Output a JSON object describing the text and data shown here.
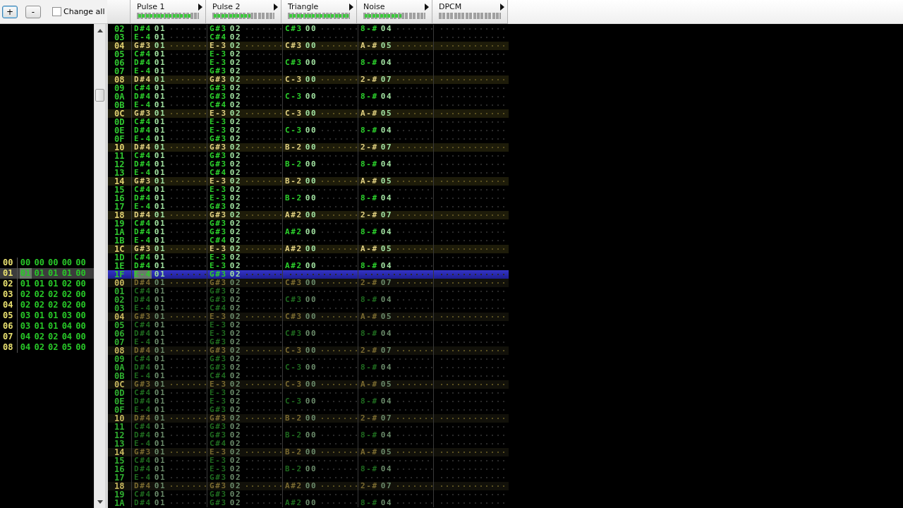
{
  "toolbar": {
    "buttons": [
      {
        "label": "+",
        "focused": true
      },
      {
        "label": "-",
        "focused": false
      }
    ],
    "change_all": {
      "label": "Change all",
      "checked": false
    }
  },
  "channels": [
    {
      "name": "Pulse 1",
      "level": 0.88
    },
    {
      "name": "Pulse 2",
      "level": 0.62
    },
    {
      "name": "Triangle",
      "level": 1
    },
    {
      "name": "Noise",
      "level": 0.62
    },
    {
      "name": "DPCM",
      "level": 0
    }
  ],
  "frames": [
    {
      "number": "00",
      "selected": false,
      "values": [
        "00",
        "00",
        "00",
        "00",
        "00"
      ]
    },
    {
      "number": "01",
      "selected": true,
      "values": [
        "01",
        "01",
        "01",
        "01",
        "00"
      ]
    },
    {
      "number": "02",
      "selected": false,
      "values": [
        "01",
        "01",
        "01",
        "02",
        "00"
      ]
    },
    {
      "number": "03",
      "selected": false,
      "values": [
        "02",
        "02",
        "02",
        "02",
        "00"
      ]
    },
    {
      "number": "04",
      "selected": false,
      "values": [
        "02",
        "02",
        "02",
        "02",
        "00"
      ]
    },
    {
      "number": "05",
      "selected": false,
      "values": [
        "03",
        "01",
        "01",
        "03",
        "00"
      ]
    },
    {
      "number": "06",
      "selected": false,
      "values": [
        "03",
        "01",
        "01",
        "04",
        "00"
      ]
    },
    {
      "number": "07",
      "selected": false,
      "values": [
        "04",
        "02",
        "02",
        "04",
        "00"
      ]
    },
    {
      "number": "08",
      "selected": false,
      "values": [
        "04",
        "02",
        "02",
        "05",
        "00"
      ]
    }
  ],
  "patterns": [
    {
      "dimmed": false,
      "rows": [
        {
          "number": "02",
          "highlighted": false,
          "selected": false,
          "cells": [
            {
              "note": "D#4",
              "instrument": "01"
            },
            {
              "note": "G#3",
              "instrument": "02"
            },
            {
              "note": "C#3",
              "instrument": "00"
            },
            {
              "note": "8-#",
              "instrument": "04"
            }
          ]
        },
        {
          "number": "03",
          "highlighted": false,
          "selected": false,
          "cells": [
            {
              "note": "E-4",
              "instrument": "01"
            },
            {
              "note": "C#4",
              "instrument": "02"
            }
          ]
        },
        {
          "number": "04",
          "highlighted": true,
          "selected": false,
          "cells": [
            {
              "note": "G#3",
              "instrument": "01"
            },
            {
              "note": "E-3",
              "instrument": "02"
            },
            {
              "note": "C#3",
              "instrument": "00"
            },
            {
              "note": "A-#",
              "instrument": "05"
            }
          ]
        },
        {
          "number": "05",
          "highlighted": false,
          "selected": false,
          "cells": [
            {
              "note": "C#4",
              "instrument": "01"
            },
            {
              "note": "E-3",
              "instrument": "02"
            }
          ]
        },
        {
          "number": "06",
          "highlighted": false,
          "selected": false,
          "cells": [
            {
              "note": "D#4",
              "instrument": "01"
            },
            {
              "note": "E-3",
              "instrument": "02"
            },
            {
              "note": "C#3",
              "instrument": "00"
            },
            {
              "note": "8-#",
              "instrument": "04"
            }
          ]
        },
        {
          "number": "07",
          "highlighted": false,
          "selected": false,
          "cells": [
            {
              "note": "E-4",
              "instrument": "01"
            },
            {
              "note": "G#3",
              "instrument": "02"
            }
          ]
        },
        {
          "number": "08",
          "highlighted": true,
          "selected": false,
          "cells": [
            {
              "note": "D#4",
              "instrument": "01"
            },
            {
              "note": "G#3",
              "instrument": "02"
            },
            {
              "note": "C-3",
              "instrument": "00"
            },
            {
              "note": "2-#",
              "instrument": "07"
            }
          ]
        },
        {
          "number": "09",
          "highlighted": false,
          "selected": false,
          "cells": [
            {
              "note": "C#4",
              "instrument": "01"
            },
            {
              "note": "G#3",
              "instrument": "02"
            }
          ]
        },
        {
          "number": "0A",
          "highlighted": false,
          "selected": false,
          "cells": [
            {
              "note": "D#4",
              "instrument": "01"
            },
            {
              "note": "G#3",
              "instrument": "02"
            },
            {
              "note": "C-3",
              "instrument": "00"
            },
            {
              "note": "8-#",
              "instrument": "04"
            }
          ]
        },
        {
          "number": "0B",
          "highlighted": false,
          "selected": false,
          "cells": [
            {
              "note": "E-4",
              "instrument": "01"
            },
            {
              "note": "C#4",
              "instrument": "02"
            }
          ]
        },
        {
          "number": "0C",
          "highlighted": true,
          "selected": false,
          "cells": [
            {
              "note": "G#3",
              "instrument": "01"
            },
            {
              "note": "E-3",
              "instrument": "02"
            },
            {
              "note": "C-3",
              "instrument": "00"
            },
            {
              "note": "A-#",
              "instrument": "05"
            }
          ]
        },
        {
          "number": "0D",
          "highlighted": false,
          "selected": false,
          "cells": [
            {
              "note": "C#4",
              "instrument": "01"
            },
            {
              "note": "E-3",
              "instrument": "02"
            }
          ]
        },
        {
          "number": "0E",
          "highlighted": false,
          "selected": false,
          "cells": [
            {
              "note": "D#4",
              "instrument": "01"
            },
            {
              "note": "E-3",
              "instrument": "02"
            },
            {
              "note": "C-3",
              "instrument": "00"
            },
            {
              "note": "8-#",
              "instrument": "04"
            }
          ]
        },
        {
          "number": "0F",
          "highlighted": false,
          "selected": false,
          "cells": [
            {
              "note": "E-4",
              "instrument": "01"
            },
            {
              "note": "G#3",
              "instrument": "02"
            }
          ]
        },
        {
          "number": "10",
          "highlighted": true,
          "selected": false,
          "cells": [
            {
              "note": "D#4",
              "instrument": "01"
            },
            {
              "note": "G#3",
              "instrument": "02"
            },
            {
              "note": "B-2",
              "instrument": "00"
            },
            {
              "note": "2-#",
              "instrument": "07"
            }
          ]
        },
        {
          "number": "11",
          "highlighted": false,
          "selected": false,
          "cells": [
            {
              "note": "C#4",
              "instrument": "01"
            },
            {
              "note": "G#3",
              "instrument": "02"
            }
          ]
        },
        {
          "number": "12",
          "highlighted": false,
          "selected": false,
          "cells": [
            {
              "note": "D#4",
              "instrument": "01"
            },
            {
              "note": "G#3",
              "instrument": "02"
            },
            {
              "note": "B-2",
              "instrument": "00"
            },
            {
              "note": "8-#",
              "instrument": "04"
            }
          ]
        },
        {
          "number": "13",
          "highlighted": false,
          "selected": false,
          "cells": [
            {
              "note": "E-4",
              "instrument": "01"
            },
            {
              "note": "C#4",
              "instrument": "02"
            }
          ]
        },
        {
          "number": "14",
          "highlighted": true,
          "selected": false,
          "cells": [
            {
              "note": "G#3",
              "instrument": "01"
            },
            {
              "note": "E-3",
              "instrument": "02"
            },
            {
              "note": "B-2",
              "instrument": "00"
            },
            {
              "note": "A-#",
              "instrument": "05"
            }
          ]
        },
        {
          "number": "15",
          "highlighted": false,
          "selected": false,
          "cells": [
            {
              "note": "C#4",
              "instrument": "01"
            },
            {
              "note": "E-3",
              "instrument": "02"
            }
          ]
        },
        {
          "number": "16",
          "highlighted": false,
          "selected": false,
          "cells": [
            {
              "note": "D#4",
              "instrument": "01"
            },
            {
              "note": "E-3",
              "instrument": "02"
            },
            {
              "note": "B-2",
              "instrument": "00"
            },
            {
              "note": "8-#",
              "instrument": "04"
            }
          ]
        },
        {
          "number": "17",
          "highlighted": false,
          "selected": false,
          "cells": [
            {
              "note": "E-4",
              "instrument": "01"
            },
            {
              "note": "G#3",
              "instrument": "02"
            }
          ]
        },
        {
          "number": "18",
          "highlighted": true,
          "selected": false,
          "cells": [
            {
              "note": "D#4",
              "instrument": "01"
            },
            {
              "note": "G#3",
              "instrument": "02"
            },
            {
              "note": "A#2",
              "instrument": "00"
            },
            {
              "note": "2-#",
              "instrument": "07"
            }
          ]
        },
        {
          "number": "19",
          "highlighted": false,
          "selected": false,
          "cells": [
            {
              "note": "C#4",
              "instrument": "01"
            },
            {
              "note": "G#3",
              "instrument": "02"
            }
          ]
        },
        {
          "number": "1A",
          "highlighted": false,
          "selected": false,
          "cells": [
            {
              "note": "D#4",
              "instrument": "01"
            },
            {
              "note": "G#3",
              "instrument": "02"
            },
            {
              "note": "A#2",
              "instrument": "00"
            },
            {
              "note": "8-#",
              "instrument": "04"
            }
          ]
        },
        {
          "number": "1B",
          "highlighted": false,
          "selected": false,
          "cells": [
            {
              "note": "E-4",
              "instrument": "01"
            },
            {
              "note": "C#4",
              "instrument": "02"
            }
          ]
        },
        {
          "number": "1C",
          "highlighted": true,
          "selected": false,
          "cells": [
            {
              "note": "G#3",
              "instrument": "01"
            },
            {
              "note": "E-3",
              "instrument": "02"
            },
            {
              "note": "A#2",
              "instrument": "00"
            },
            {
              "note": "A-#",
              "instrument": "05"
            }
          ]
        },
        {
          "number": "1D",
          "highlighted": false,
          "selected": false,
          "cells": [
            {
              "note": "C#4",
              "instrument": "01"
            },
            {
              "note": "E-3",
              "instrument": "02"
            }
          ]
        },
        {
          "number": "1E",
          "highlighted": false,
          "selected": false,
          "cells": [
            {
              "note": "D#4",
              "instrument": "01"
            },
            {
              "note": "E-3",
              "instrument": "02"
            },
            {
              "note": "A#2",
              "instrument": "00"
            },
            {
              "note": "8-#",
              "instrument": "04"
            }
          ]
        },
        {
          "number": "1F",
          "highlighted": false,
          "selected": true,
          "cells": [
            {
              "note": "E-4",
              "instrument": "01",
              "cursor": true
            },
            {
              "note": "G#3",
              "instrument": "02"
            }
          ]
        }
      ]
    },
    {
      "dimmed": true,
      "rows": [
        {
          "number": "00",
          "highlighted": true,
          "selected": false,
          "cells": [
            {
              "note": "D#4",
              "instrument": "01"
            },
            {
              "note": "G#3",
              "instrument": "02"
            },
            {
              "note": "C#3",
              "instrument": "00"
            },
            {
              "note": "2-#",
              "instrument": "07"
            }
          ]
        },
        {
          "number": "01",
          "highlighted": false,
          "selected": false,
          "cells": [
            {
              "note": "C#4",
              "instrument": "01"
            },
            {
              "note": "G#3",
              "instrument": "02"
            }
          ]
        },
        {
          "number": "02",
          "highlighted": false,
          "selected": false,
          "cells": [
            {
              "note": "D#4",
              "instrument": "01"
            },
            {
              "note": "G#3",
              "instrument": "02"
            },
            {
              "note": "C#3",
              "instrument": "00"
            },
            {
              "note": "8-#",
              "instrument": "04"
            }
          ]
        },
        {
          "number": "03",
          "highlighted": false,
          "selected": false,
          "cells": [
            {
              "note": "E-4",
              "instrument": "01"
            },
            {
              "note": "C#4",
              "instrument": "02"
            }
          ]
        },
        {
          "number": "04",
          "highlighted": true,
          "selected": false,
          "cells": [
            {
              "note": "G#3",
              "instrument": "01"
            },
            {
              "note": "E-3",
              "instrument": "02"
            },
            {
              "note": "C#3",
              "instrument": "00"
            },
            {
              "note": "A-#",
              "instrument": "05"
            }
          ]
        },
        {
          "number": "05",
          "highlighted": false,
          "selected": false,
          "cells": [
            {
              "note": "C#4",
              "instrument": "01"
            },
            {
              "note": "E-3",
              "instrument": "02"
            }
          ]
        },
        {
          "number": "06",
          "highlighted": false,
          "selected": false,
          "cells": [
            {
              "note": "D#4",
              "instrument": "01"
            },
            {
              "note": "E-3",
              "instrument": "02"
            },
            {
              "note": "C#3",
              "instrument": "00"
            },
            {
              "note": "8-#",
              "instrument": "04"
            }
          ]
        },
        {
          "number": "07",
          "highlighted": false,
          "selected": false,
          "cells": [
            {
              "note": "E-4",
              "instrument": "01"
            },
            {
              "note": "G#3",
              "instrument": "02"
            }
          ]
        },
        {
          "number": "08",
          "highlighted": true,
          "selected": false,
          "cells": [
            {
              "note": "D#4",
              "instrument": "01"
            },
            {
              "note": "G#3",
              "instrument": "02"
            },
            {
              "note": "C-3",
              "instrument": "00"
            },
            {
              "note": "2-#",
              "instrument": "07"
            }
          ]
        },
        {
          "number": "09",
          "highlighted": false,
          "selected": false,
          "cells": [
            {
              "note": "C#4",
              "instrument": "01"
            },
            {
              "note": "G#3",
              "instrument": "02"
            }
          ]
        },
        {
          "number": "0A",
          "highlighted": false,
          "selected": false,
          "cells": [
            {
              "note": "D#4",
              "instrument": "01"
            },
            {
              "note": "G#3",
              "instrument": "02"
            },
            {
              "note": "C-3",
              "instrument": "00"
            },
            {
              "note": "8-#",
              "instrument": "04"
            }
          ]
        },
        {
          "number": "0B",
          "highlighted": false,
          "selected": false,
          "cells": [
            {
              "note": "E-4",
              "instrument": "01"
            },
            {
              "note": "C#4",
              "instrument": "02"
            }
          ]
        },
        {
          "number": "0C",
          "highlighted": true,
          "selected": false,
          "cells": [
            {
              "note": "G#3",
              "instrument": "01"
            },
            {
              "note": "E-3",
              "instrument": "02"
            },
            {
              "note": "C-3",
              "instrument": "00"
            },
            {
              "note": "A-#",
              "instrument": "05"
            }
          ]
        },
        {
          "number": "0D",
          "highlighted": false,
          "selected": false,
          "cells": [
            {
              "note": "C#4",
              "instrument": "01"
            },
            {
              "note": "E-3",
              "instrument": "02"
            }
          ]
        },
        {
          "number": "0E",
          "highlighted": false,
          "selected": false,
          "cells": [
            {
              "note": "D#4",
              "instrument": "01"
            },
            {
              "note": "E-3",
              "instrument": "02"
            },
            {
              "note": "C-3",
              "instrument": "00"
            },
            {
              "note": "8-#",
              "instrument": "04"
            }
          ]
        },
        {
          "number": "0F",
          "highlighted": false,
          "selected": false,
          "cells": [
            {
              "note": "E-4",
              "instrument": "01"
            },
            {
              "note": "G#3",
              "instrument": "02"
            }
          ]
        },
        {
          "number": "10",
          "highlighted": true,
          "selected": false,
          "cells": [
            {
              "note": "D#4",
              "instrument": "01"
            },
            {
              "note": "G#3",
              "instrument": "02"
            },
            {
              "note": "B-2",
              "instrument": "00"
            },
            {
              "note": "2-#",
              "instrument": "07"
            }
          ]
        },
        {
          "number": "11",
          "highlighted": false,
          "selected": false,
          "cells": [
            {
              "note": "C#4",
              "instrument": "01"
            },
            {
              "note": "G#3",
              "instrument": "02"
            }
          ]
        },
        {
          "number": "12",
          "highlighted": false,
          "selected": false,
          "cells": [
            {
              "note": "D#4",
              "instrument": "01"
            },
            {
              "note": "G#3",
              "instrument": "02"
            },
            {
              "note": "B-2",
              "instrument": "00"
            },
            {
              "note": "8-#",
              "instrument": "04"
            }
          ]
        },
        {
          "number": "13",
          "highlighted": false,
          "selected": false,
          "cells": [
            {
              "note": "E-4",
              "instrument": "01"
            },
            {
              "note": "C#4",
              "instrument": "02"
            }
          ]
        },
        {
          "number": "14",
          "highlighted": true,
          "selected": false,
          "cells": [
            {
              "note": "G#3",
              "instrument": "01"
            },
            {
              "note": "E-3",
              "instrument": "02"
            },
            {
              "note": "B-2",
              "instrument": "00"
            },
            {
              "note": "A-#",
              "instrument": "05"
            }
          ]
        },
        {
          "number": "15",
          "highlighted": false,
          "selected": false,
          "cells": [
            {
              "note": "C#4",
              "instrument": "01"
            },
            {
              "note": "E-3",
              "instrument": "02"
            }
          ]
        },
        {
          "number": "16",
          "highlighted": false,
          "selected": false,
          "cells": [
            {
              "note": "D#4",
              "instrument": "01"
            },
            {
              "note": "E-3",
              "instrument": "02"
            },
            {
              "note": "B-2",
              "instrument": "00"
            },
            {
              "note": "8-#",
              "instrument": "04"
            }
          ]
        },
        {
          "number": "17",
          "highlighted": false,
          "selected": false,
          "cells": [
            {
              "note": "E-4",
              "instrument": "01"
            },
            {
              "note": "G#3",
              "instrument": "02"
            }
          ]
        },
        {
          "number": "18",
          "highlighted": true,
          "selected": false,
          "cells": [
            {
              "note": "D#4",
              "instrument": "01"
            },
            {
              "note": "G#3",
              "instrument": "02"
            },
            {
              "note": "A#2",
              "instrument": "00"
            },
            {
              "note": "2-#",
              "instrument": "07"
            }
          ]
        },
        {
          "number": "19",
          "highlighted": false,
          "selected": false,
          "cells": [
            {
              "note": "C#4",
              "instrument": "01"
            },
            {
              "note": "G#3",
              "instrument": "02"
            }
          ]
        },
        {
          "number": "1A",
          "highlighted": false,
          "selected": false,
          "cells": [
            {
              "note": "D#4",
              "instrument": "01"
            },
            {
              "note": "G#3",
              "instrument": "02"
            },
            {
              "note": "A#2",
              "instrument": "00"
            },
            {
              "note": "8-#",
              "instrument": "04"
            }
          ]
        }
      ]
    }
  ]
}
